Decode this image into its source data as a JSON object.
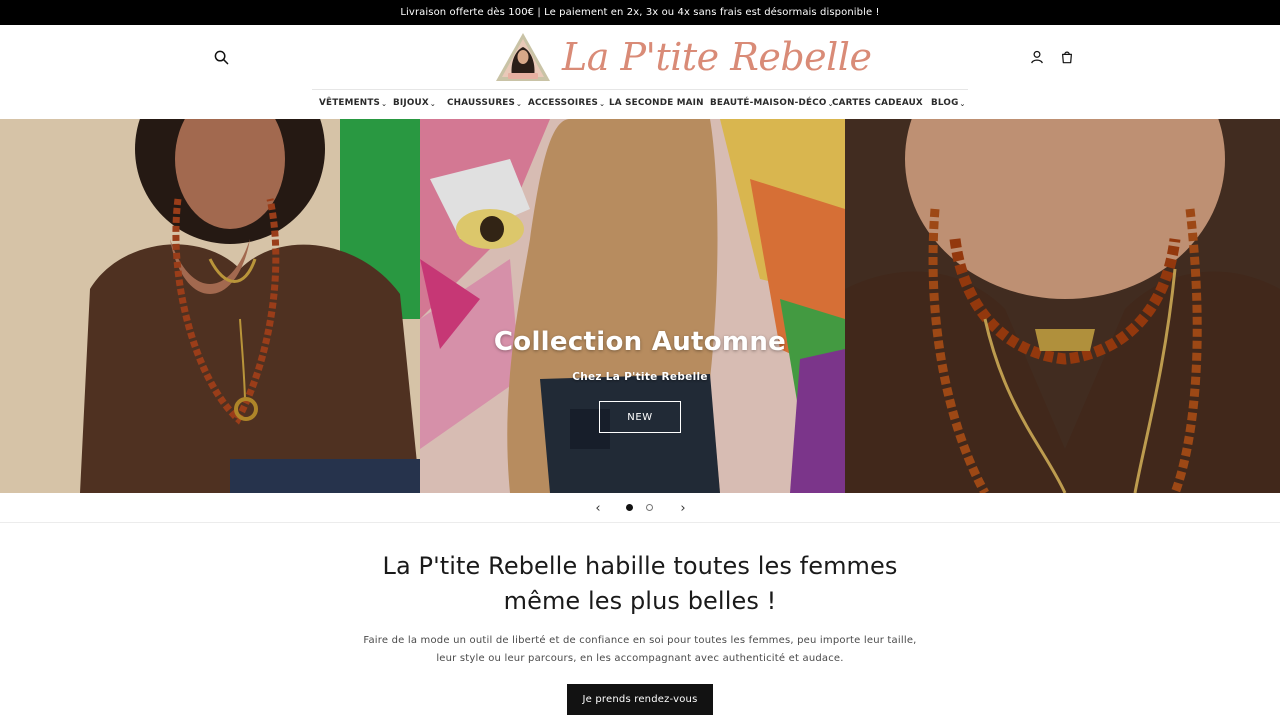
{
  "announcement": {
    "text": "Livraison offerte dès 100€ | Le paiement en 2x, 3x ou 4x sans frais est désormais disponible !"
  },
  "header": {
    "brand": "La P'tite Rebelle",
    "icons": {
      "search": "search-icon",
      "account": "user-icon",
      "cart": "cart-icon"
    },
    "brand_color": "#d98b77"
  },
  "nav": {
    "items": [
      {
        "label": "VÊTEMENTS",
        "has_dropdown": true
      },
      {
        "label": "BIJOUX",
        "has_dropdown": true
      },
      {
        "label": "CHAUSSURES",
        "has_dropdown": true
      },
      {
        "label": "ACCESSOIRES",
        "has_dropdown": true
      },
      {
        "label": "LA SECONDE MAIN",
        "has_dropdown": false
      },
      {
        "label": "BEAUTÉ-MAISON-DÉCO",
        "has_dropdown": true
      },
      {
        "label": "CARTES CADEAUX",
        "has_dropdown": false
      },
      {
        "label": "BLOG",
        "has_dropdown": true
      }
    ]
  },
  "hero": {
    "title": "Collection Automne",
    "subtitle": "Chez La P'tite Rebelle",
    "button_label": "NEW"
  },
  "slider": {
    "prev_icon": "chevron-left-icon",
    "next_icon": "chevron-right-icon",
    "slide_count": 2,
    "active_slide": 1
  },
  "intro": {
    "title_line1": "La P'tite Rebelle habille toutes les femmes",
    "title_line2": "même les plus belles !",
    "text_line1": "Faire de la mode un outil de liberté et de confiance en soi pour toutes les femmes, peu importe leur taille,",
    "text_line2": "leur style ou leur parcours, en les accompagnant avec authenticité et audace.",
    "cta_label": "Je prends rendez-vous"
  }
}
